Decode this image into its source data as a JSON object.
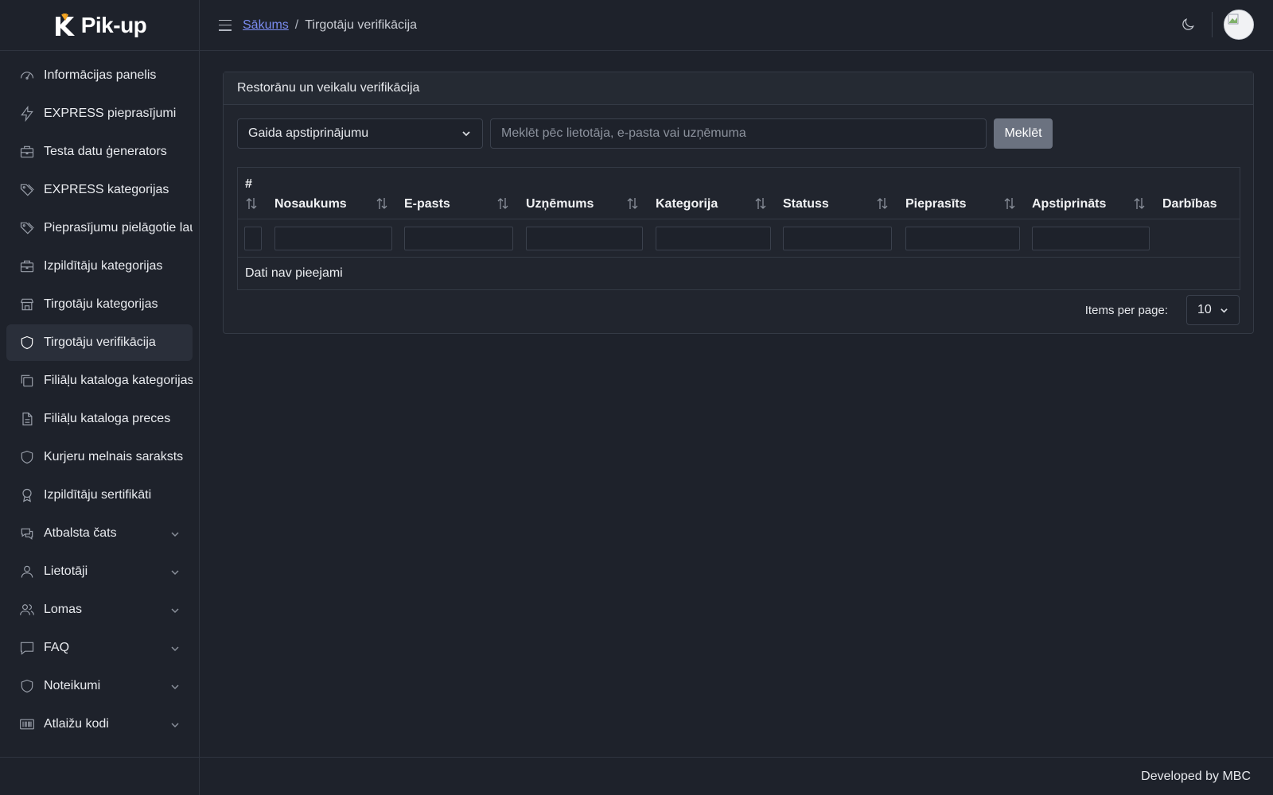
{
  "app": {
    "logo_text": "Pik-up"
  },
  "sidebar": {
    "items": [
      {
        "label": "Informācijas panelis",
        "icon": "dashboard-icon",
        "active": false,
        "expandable": false
      },
      {
        "label": "EXPRESS pieprasījumi",
        "icon": "lightning-icon",
        "active": false,
        "expandable": false
      },
      {
        "label": "Testa datu ģenerators",
        "icon": "briefcase-icon",
        "active": false,
        "expandable": false
      },
      {
        "label": "EXPRESS kategorijas",
        "icon": "tags-icon",
        "active": false,
        "expandable": false
      },
      {
        "label": "Pieprasījumu pielāgotie lauki",
        "icon": "tags-icon",
        "active": false,
        "expandable": false
      },
      {
        "label": "Izpildītāju kategorijas",
        "icon": "briefcase-icon",
        "active": false,
        "expandable": false
      },
      {
        "label": "Tirgotāju kategorijas",
        "icon": "store-icon",
        "active": false,
        "expandable": false
      },
      {
        "label": "Tirgotāju verifikācija",
        "icon": "shield-icon",
        "active": true,
        "expandable": false
      },
      {
        "label": "Filiāļu kataloga kategorijas",
        "icon": "copy-icon",
        "active": false,
        "expandable": false
      },
      {
        "label": "Filiāļu kataloga preces",
        "icon": "file-icon",
        "active": false,
        "expandable": false
      },
      {
        "label": "Kurjeru melnais saraksts",
        "icon": "shield-icon",
        "active": false,
        "expandable": false
      },
      {
        "label": "Izpildītāju sertifikāti",
        "icon": "award-icon",
        "active": false,
        "expandable": false
      },
      {
        "label": "Atbalsta čats",
        "icon": "chat-icon",
        "active": false,
        "expandable": true
      },
      {
        "label": "Lietotāji",
        "icon": "user-icon",
        "active": false,
        "expandable": true
      },
      {
        "label": "Lomas",
        "icon": "users-icon",
        "active": false,
        "expandable": true
      },
      {
        "label": "FAQ",
        "icon": "message-square-icon",
        "active": false,
        "expandable": true
      },
      {
        "label": "Noteikumi",
        "icon": "shield-icon",
        "active": false,
        "expandable": true
      },
      {
        "label": "Atlaižu kodi",
        "icon": "barcode-icon",
        "active": false,
        "expandable": true
      }
    ]
  },
  "header": {
    "breadcrumb_home": "Sākums",
    "breadcrumb_sep": "/",
    "breadcrumb_current": "Tirgotāju verifikācija"
  },
  "card": {
    "title": "Restorānu un veikalu verifikācija",
    "status_filter": "Gaida apstiprinājumu",
    "search_placeholder": "Meklēt pēc lietotāja, e-pasta vai uzņēmuma",
    "search_button": "Meklēt"
  },
  "table": {
    "columns": [
      "#",
      "Nosaukums",
      "E-pasts",
      "Uzņēmums",
      "Kategorija",
      "Statuss",
      "Pieprasīts",
      "Apstiprināts",
      "Darbības"
    ],
    "empty_text": "Dati nav pieejami"
  },
  "pagination": {
    "label": "Items per page:",
    "value": "10"
  },
  "footer": {
    "text": "Developed by MBC"
  }
}
